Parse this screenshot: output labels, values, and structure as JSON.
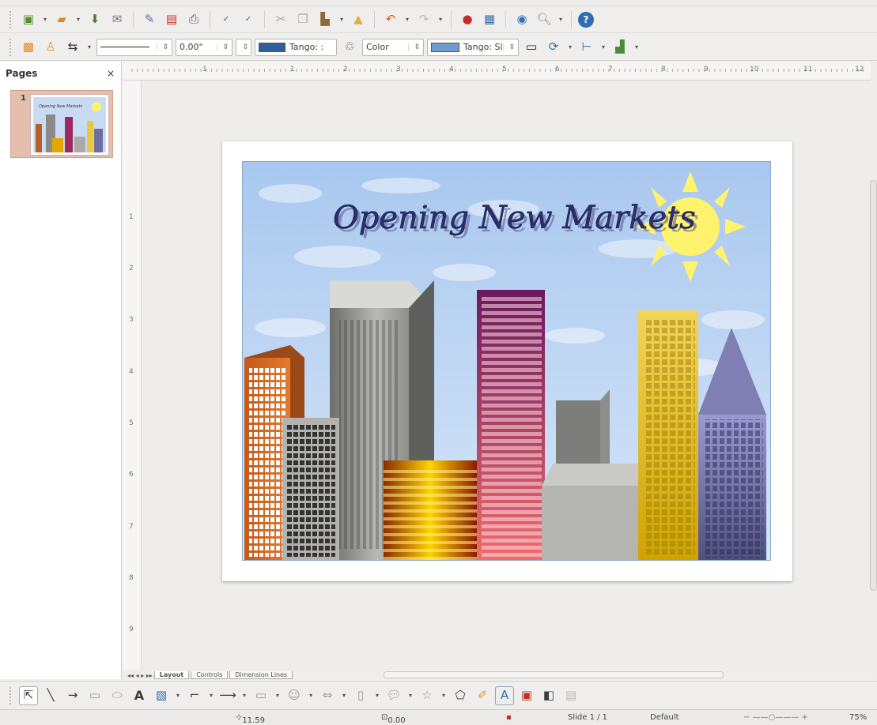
{
  "toolbar_standard": {
    "icons": [
      "new-document-icon",
      "open-folder-icon",
      "save-icon",
      "email-icon",
      "edit-file-icon",
      "export-pdf-icon",
      "print-icon",
      "spellcheck-icon",
      "autospellcheck-icon",
      "cut-icon",
      "copy-icon",
      "paste-icon",
      "clone-formatting-icon",
      "undo-icon",
      "redo-icon",
      "chart-icon",
      "table-icon",
      "navigator-icon",
      "zoom-icon",
      "help-icon"
    ]
  },
  "toolbar_line_fill": {
    "line_width": "0.00\"",
    "line_color": "Tango: :",
    "area_style": "Color",
    "area_color": "Tango: Sl",
    "colors": {
      "line_swatch": "#2f5f9a",
      "area_swatch": "#6f9bd0"
    }
  },
  "pages_panel": {
    "title": "Pages",
    "close": "×",
    "thumbnails": [
      {
        "number": "1",
        "title": "Opening New Markets"
      }
    ]
  },
  "ruler": {
    "h_marks": [
      "1",
      "1",
      "2",
      "3",
      "4",
      "5",
      "6",
      "7",
      "8",
      "9",
      "10",
      "11",
      "12"
    ],
    "v_marks": [
      "1",
      "2",
      "3",
      "4",
      "5",
      "6",
      "7",
      "8",
      "9"
    ]
  },
  "slide": {
    "title": "Opening New Markets",
    "colors": {
      "sky": "#b9d3f3",
      "sun": "#fff36e",
      "title": "#2b2f6e"
    }
  },
  "view_tabs": [
    "Layout",
    "Controls",
    "Dimension Lines"
  ],
  "status_bar": {
    "position": "11.59 / -0.02",
    "size": "0.00 x 0.00",
    "slide": "Slide 1 / 1",
    "layout": "Default",
    "zoom": "75%"
  }
}
